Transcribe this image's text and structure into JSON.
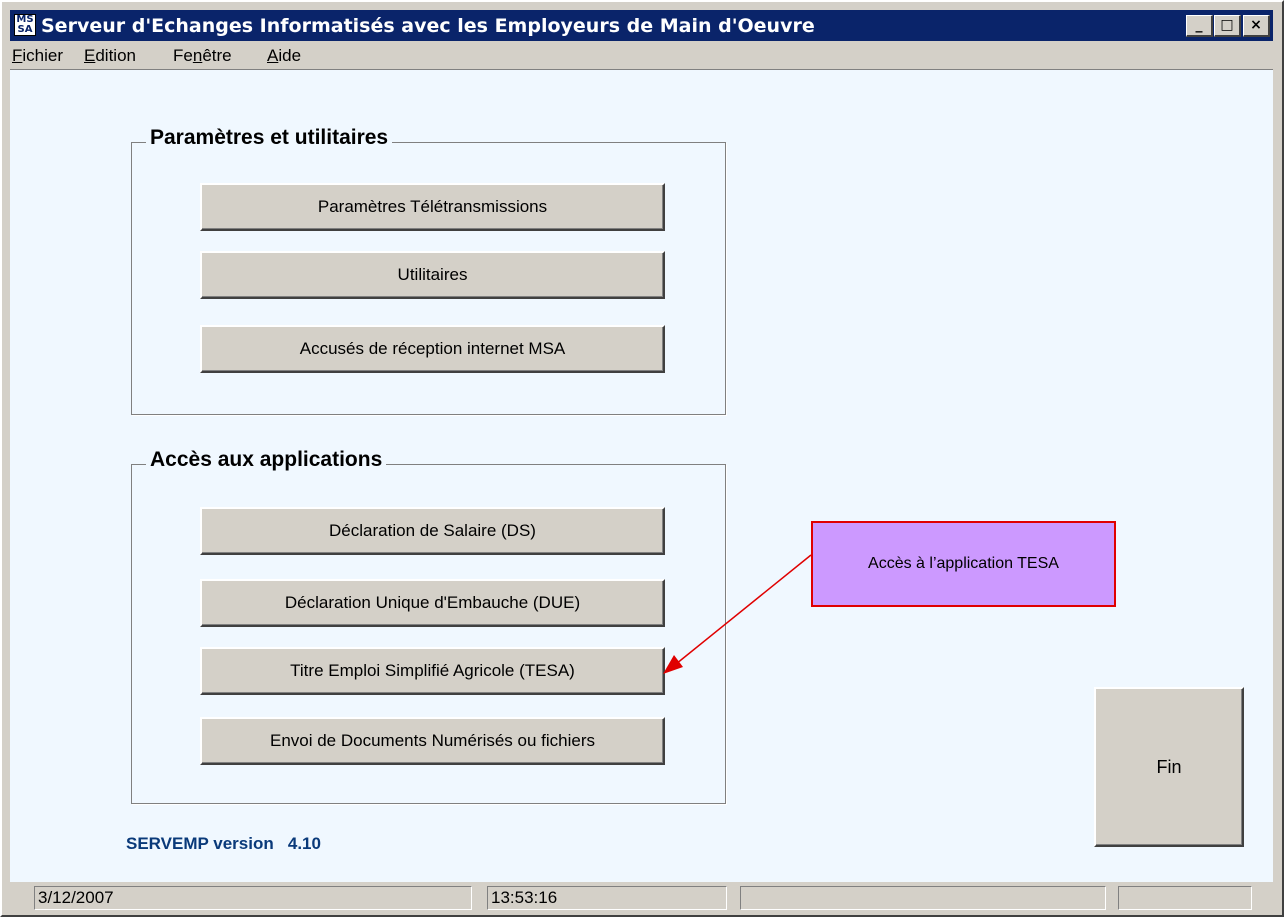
{
  "window": {
    "title": "Serveur d'Echanges Informatisés avec les Employeurs de Main d'Oeuvre",
    "controls": {
      "minimize": "_",
      "maximize": "□",
      "close": "×"
    }
  },
  "menu": [
    {
      "label": "Fichier",
      "mnemonic": "F",
      "rest": "ichier"
    },
    {
      "label": "Edition",
      "mnemonic": "E",
      "rest": "dition"
    },
    {
      "label": "Fenêtre",
      "pre": "Fe",
      "mnemonic": "n",
      "rest": "être"
    },
    {
      "label": "Aide",
      "mnemonic": "A",
      "rest": "ide"
    }
  ],
  "groups": {
    "params": {
      "title": "Paramètres et utilitaires",
      "buttons": [
        {
          "label": "Paramètres Télétransmissions"
        },
        {
          "label": "Utilitaires"
        },
        {
          "label": "Accusés de réception internet MSA"
        }
      ]
    },
    "apps": {
      "title": "Accès aux applications",
      "buttons": [
        {
          "label": "Déclaration de Salaire (DS)"
        },
        {
          "label": "Déclaration Unique d'Embauche (DUE)"
        },
        {
          "label": "Titre Emploi Simplifié Agricole (TESA)"
        },
        {
          "label": "Envoi de Documents Numérisés ou fichiers"
        }
      ]
    }
  },
  "fin_button": {
    "label": "Fin"
  },
  "version_text": "SERVEMP version   4.10",
  "callout": {
    "text": "Accès à l’application TESA",
    "fill": "#cc99ff",
    "border": "#e00000"
  },
  "status": {
    "date": "3/12/2007",
    "time": "13:53:16",
    "pane3": "",
    "pane4": ""
  }
}
